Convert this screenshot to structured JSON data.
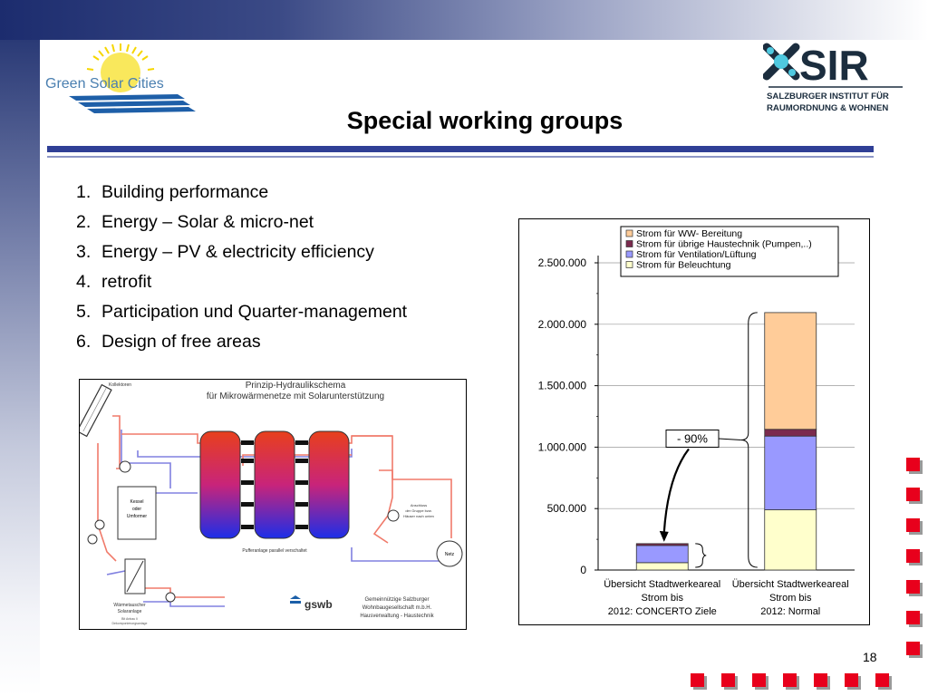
{
  "slide": {
    "title": "Special working groups",
    "page_number": "18",
    "list": [
      {
        "num": "1.",
        "text": "Building performance"
      },
      {
        "num": "2.",
        "text": "Energy – Solar & micro-net"
      },
      {
        "num": "3.",
        "text": "Energy – PV & electricity efficiency"
      },
      {
        "num": "4.",
        "text": "retrofit"
      },
      {
        "num": "5.",
        "text": "Participation und Quarter-management"
      },
      {
        "num": "6.",
        "text": "Design of free areas"
      }
    ]
  },
  "logos": {
    "green_solar_cities": "Green Solar Cities",
    "sir_letters": "SIR",
    "sir_line1": "SALZBURGER INSTITUT FÜR",
    "sir_line2": "RAUMORDNUNG & WOHNEN"
  },
  "hydraulic": {
    "title_line1": "Prinzip-Hydraulikschema",
    "title_line2": "für Mikrowärmenetze mit Solarunterstützung",
    "kollektoren": "Kollektoren",
    "kessel_line1": "Kessel",
    "kessel_line2": "oder",
    "kessel_line3": "Umformer",
    "puffer": "Pufferanlage parallel verschaltet",
    "netz": "Netz",
    "anschluss_line1": "Anschluss",
    "anschluss_line2": "der Gruppe bzw.",
    "anschluss_line3": "Häuser nach unten",
    "wt_line1": "Wärmetauscher",
    "wt_line2": "Solaranlage",
    "wt_small_line1": "Bit Anbau Ii",
    "wt_small_line2": "Dekomponierungsanlage",
    "gswb_logo": "gswb",
    "gswb_line1": "Gemeinnützige Salzburger",
    "gswb_line2": "Wohnbaugesellschaft m.b.H.",
    "gswb_line3": "Hausverwaltung - Haustechnik"
  },
  "chart_data": {
    "type": "bar",
    "stacked": true,
    "categories": [
      [
        "Übersicht Stadtwerkeareal",
        "Strom bis",
        "2012: CONCERTO Ziele"
      ],
      [
        "Übersicht Stadtwerkeareal",
        "Strom bis",
        "2012: Normal"
      ]
    ],
    "series": [
      {
        "name": "Strom für Beleuchtung",
        "color": "#ffffcc",
        "values": [
          60000,
          490000
        ]
      },
      {
        "name": "Strom für Ventilation/Lüftung",
        "color": "#9999ff",
        "values": [
          140000,
          600000
        ]
      },
      {
        "name": "Strom für übrige Haustechnik (Pumpen,..)",
        "color": "#7b2a4e",
        "values": [
          15000,
          55000
        ]
      },
      {
        "name": "Strom für WW- Bereitung",
        "color": "#ffcc99",
        "values": [
          0,
          950000
        ]
      }
    ],
    "legend_order": [
      "Strom für WW- Bereitung",
      "Strom für übrige Haustechnik (Pumpen,..)",
      "Strom für Ventilation/Lüftung",
      "Strom für Beleuchtung"
    ],
    "yticks": [
      "0",
      "500.000",
      "1.000.000",
      "1.500.000",
      "2.000.000",
      "2.500.000"
    ],
    "ylim": [
      0,
      2500000
    ],
    "ytick_step": 500000,
    "grid": true,
    "legend_position": "top",
    "annotation": "- 90%"
  },
  "colors": {
    "accent_blue": "#2f3f96",
    "square_red": "#e8001c",
    "tank_red": "#e8401c",
    "tank_blue": "#1c2ee8"
  }
}
